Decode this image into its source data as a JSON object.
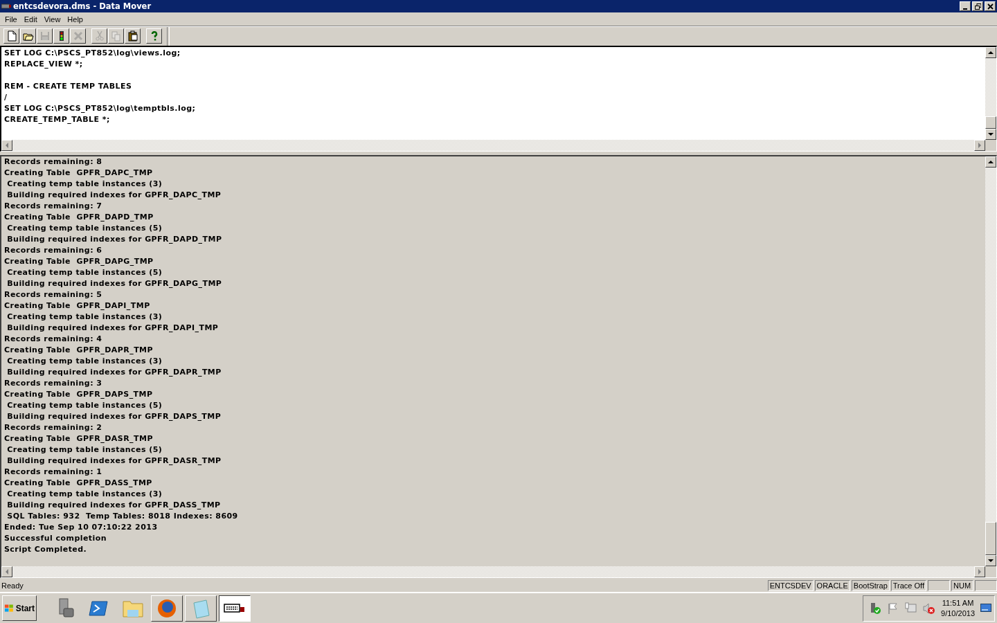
{
  "window": {
    "title": "entcsdevora.dms - Data Mover"
  },
  "menu": [
    "File",
    "Edit",
    "View",
    "Help"
  ],
  "toolbar": [
    {
      "kind": "new",
      "disabled": false
    },
    {
      "kind": "open",
      "disabled": false
    },
    {
      "kind": "save",
      "disabled": true
    },
    {
      "kind": "run",
      "disabled": false
    },
    {
      "kind": "stop",
      "disabled": true
    },
    {
      "kind": "sep"
    },
    {
      "kind": "cut",
      "disabled": true
    },
    {
      "kind": "copy",
      "disabled": true
    },
    {
      "kind": "paste",
      "disabled": false
    },
    {
      "kind": "sep"
    },
    {
      "kind": "help",
      "disabled": false
    }
  ],
  "editor": {
    "lines": [
      {
        "kind": "text",
        "text": "SET LOG C:\\PSCS_PT852\\log\\views.log;"
      },
      {
        "kind": "text",
        "text": "REPLACE_VIEW *;"
      },
      {
        "kind": "blank"
      },
      {
        "kind": "text",
        "text": "REM - CREATE TEMP TABLES"
      },
      {
        "kind": "text",
        "text": "/"
      },
      {
        "kind": "text",
        "text": "SET LOG C:\\PSCS_PT852\\log\\temptbls.log;"
      },
      {
        "kind": "text",
        "text": "CREATE_TEMP_TABLE *;"
      }
    ]
  },
  "log": {
    "lines": [
      "Records remaining: 8",
      "Creating Table  GPFR_DAPC_TMP",
      " Creating temp table instances (3)",
      " Building required indexes for GPFR_DAPC_TMP",
      "Records remaining: 7",
      "Creating Table  GPFR_DAPD_TMP",
      " Creating temp table instances (5)",
      " Building required indexes for GPFR_DAPD_TMP",
      "Records remaining: 6",
      "Creating Table  GPFR_DAPG_TMP",
      " Creating temp table instances (5)",
      " Building required indexes for GPFR_DAPG_TMP",
      "Records remaining: 5",
      "Creating Table  GPFR_DAPI_TMP",
      " Creating temp table instances (3)",
      " Building required indexes for GPFR_DAPI_TMP",
      "Records remaining: 4",
      "Creating Table  GPFR_DAPR_TMP",
      " Creating temp table instances (3)",
      " Building required indexes for GPFR_DAPR_TMP",
      "Records remaining: 3",
      "Creating Table  GPFR_DAPS_TMP",
      " Creating temp table instances (5)",
      " Building required indexes for GPFR_DAPS_TMP",
      "Records remaining: 2",
      "Creating Table  GPFR_DASR_TMP",
      " Creating temp table instances (5)",
      " Building required indexes for GPFR_DASR_TMP",
      "Records remaining: 1",
      "Creating Table  GPFR_DASS_TMP",
      " Creating temp table instances (3)",
      " Building required indexes for GPFR_DASS_TMP",
      " SQL Tables: 932  Temp Tables: 8018 Indexes: 8609",
      "Ended: Tue Sep 10 07:10:22 2013",
      "Successful completion",
      "Script Completed."
    ]
  },
  "status_bar": {
    "message": "Ready",
    "panes": [
      {
        "kind": "text",
        "text": "ENTCSDEV"
      },
      {
        "kind": "text",
        "text": "ORACLE"
      },
      {
        "kind": "text",
        "text": "BootStrap"
      },
      {
        "kind": "text",
        "text": "Trace Off"
      },
      {
        "kind": "blank"
      },
      {
        "kind": "text",
        "text": "NUM"
      },
      {
        "kind": "blank"
      }
    ]
  },
  "taskbar": {
    "start": "Start",
    "apps": [
      {
        "kind": "server",
        "running": false,
        "selected": false
      },
      {
        "kind": "shell",
        "running": false,
        "selected": false
      },
      {
        "kind": "folder",
        "running": false,
        "selected": false
      },
      {
        "kind": "browser",
        "running": true,
        "selected": false
      },
      {
        "kind": "notepad",
        "running": true,
        "selected": false
      },
      {
        "kind": "datamover",
        "running": true,
        "selected": true
      }
    ],
    "tray": {
      "time": "11:51 AM",
      "date": "9/10/2013"
    }
  }
}
